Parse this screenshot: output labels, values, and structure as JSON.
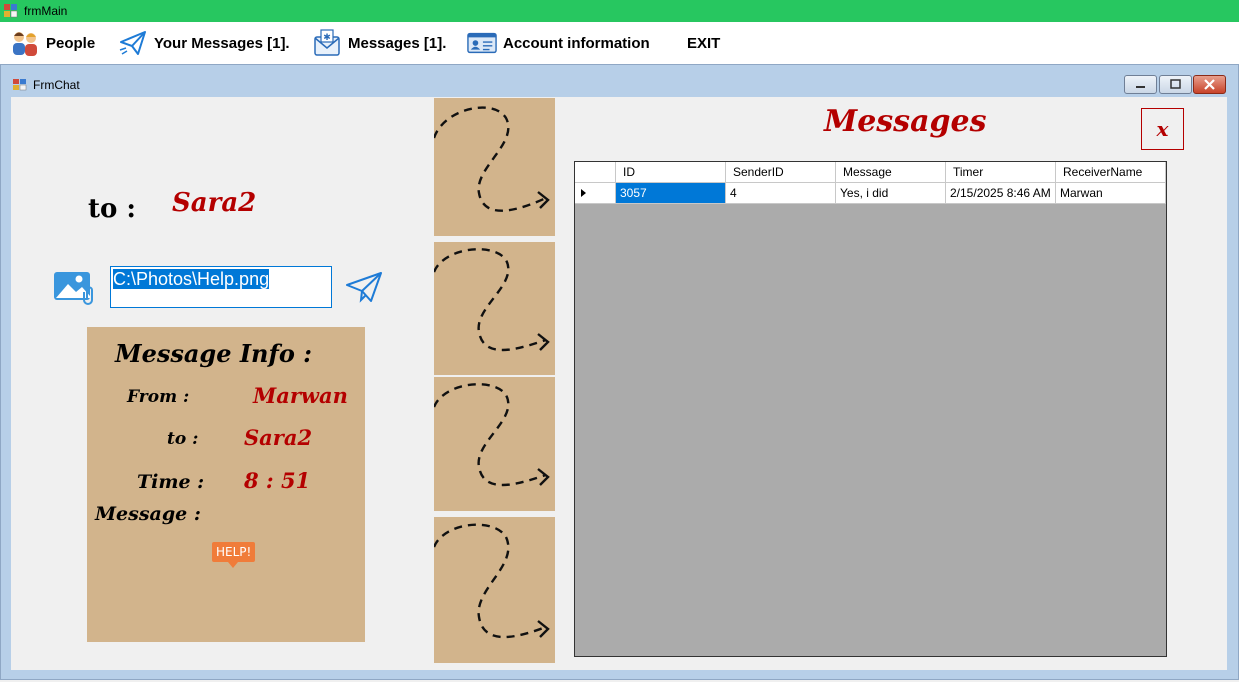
{
  "app": {
    "title": "frmMain"
  },
  "menu": {
    "items": [
      {
        "label": "People",
        "icon": "people-icon"
      },
      {
        "label": "Your Messages [1].",
        "icon": "paper-plane-icon"
      },
      {
        "label": "Messages [1].",
        "icon": "envelope-icon"
      },
      {
        "label": "Account information",
        "icon": "id-card-icon"
      },
      {
        "label": "EXIT"
      }
    ]
  },
  "chat_window": {
    "title": "FrmChat",
    "to_label": "to :",
    "to_value": "Sara2",
    "photo_path": "C:\\Photos\\Help.png",
    "info": {
      "heading": "Message Info :",
      "from_label": "From :",
      "from_value": "Marwan",
      "to_label": "to :",
      "to_value": "Sara2",
      "time_label": "Time :",
      "time_value": "8 : 51",
      "message_label": "Message :",
      "sticker_text": "HELP!"
    }
  },
  "messages_panel": {
    "title": "Messages",
    "close_label": "x",
    "columns": [
      "ID",
      "SenderID",
      "Message",
      "Timer",
      "ReceiverName"
    ],
    "rows": [
      [
        "3057",
        "4",
        "Yes, i did",
        "2/15/2025 8:46 AM",
        "Marwan"
      ]
    ]
  },
  "colors": {
    "titlebar": "#27c760",
    "accent_red": "#b40000",
    "panel_tan": "#d2b48c",
    "selection": "#0078d7",
    "grid_bg": "#ababab"
  }
}
